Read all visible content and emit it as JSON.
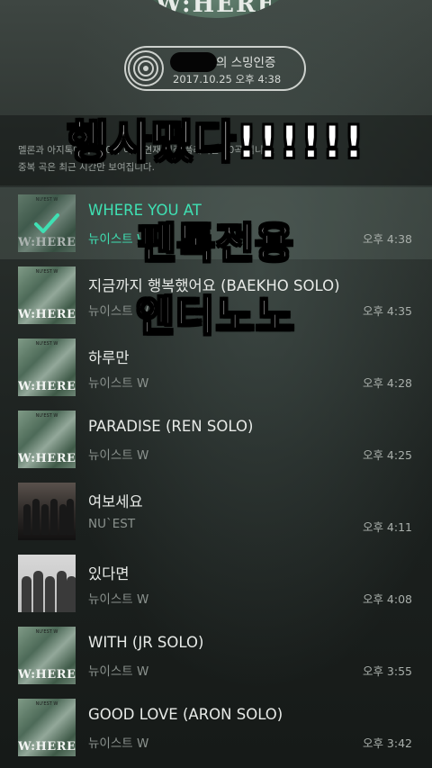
{
  "header": {
    "album_word": "W:HERE",
    "cert_title": "의 스밍인증",
    "cert_date": "2017.10.25 오후 4:38"
  },
  "info": {
    "line1": "멜론과 아지톡에서 100사 이내 연재 기준 플레이한 10곡 입니다.",
    "line2": "중복 곡은 최근 시간만 보여집니다."
  },
  "overlay": {
    "line1": "행사떴다!!!!!!",
    "line2": "팬톡전용",
    "line3": "엔터노노"
  },
  "tracks": [
    {
      "title": "WHERE YOU AT",
      "artist": "뉴이스트 W",
      "time": "오후 4:38",
      "art": "where",
      "selected": true
    },
    {
      "title": "지금까지 행복했어요 (BAEKHO SOLO)",
      "artist": "뉴이스트 W",
      "time": "오후 4:35",
      "art": "where"
    },
    {
      "title": "하루만",
      "artist": "뉴이스트 W",
      "time": "오후 4:28",
      "art": "where"
    },
    {
      "title": "PARADISE (REN SOLO)",
      "artist": "뉴이스트 W",
      "time": "오후 4:25",
      "art": "where"
    },
    {
      "title": "여보세요",
      "artist": "NU`EST",
      "time": "오후 4:11",
      "art": "group"
    },
    {
      "title": "있다면",
      "artist": "뉴이스트 W",
      "time": "오후 4:08",
      "art": "bw"
    },
    {
      "title": "WITH (JR SOLO)",
      "artist": "뉴이스트 W",
      "time": "오후 3:55",
      "art": "where"
    },
    {
      "title": "GOOD LOVE (ARON SOLO)",
      "artist": "뉴이스트 W",
      "time": "오후 3:42",
      "art": "where"
    }
  ],
  "thumb_text": {
    "where_word": "W:HERE",
    "where_top": "NU'EST W"
  },
  "colors": {
    "accent": "#3fe0b3",
    "background": "#1e2421"
  }
}
